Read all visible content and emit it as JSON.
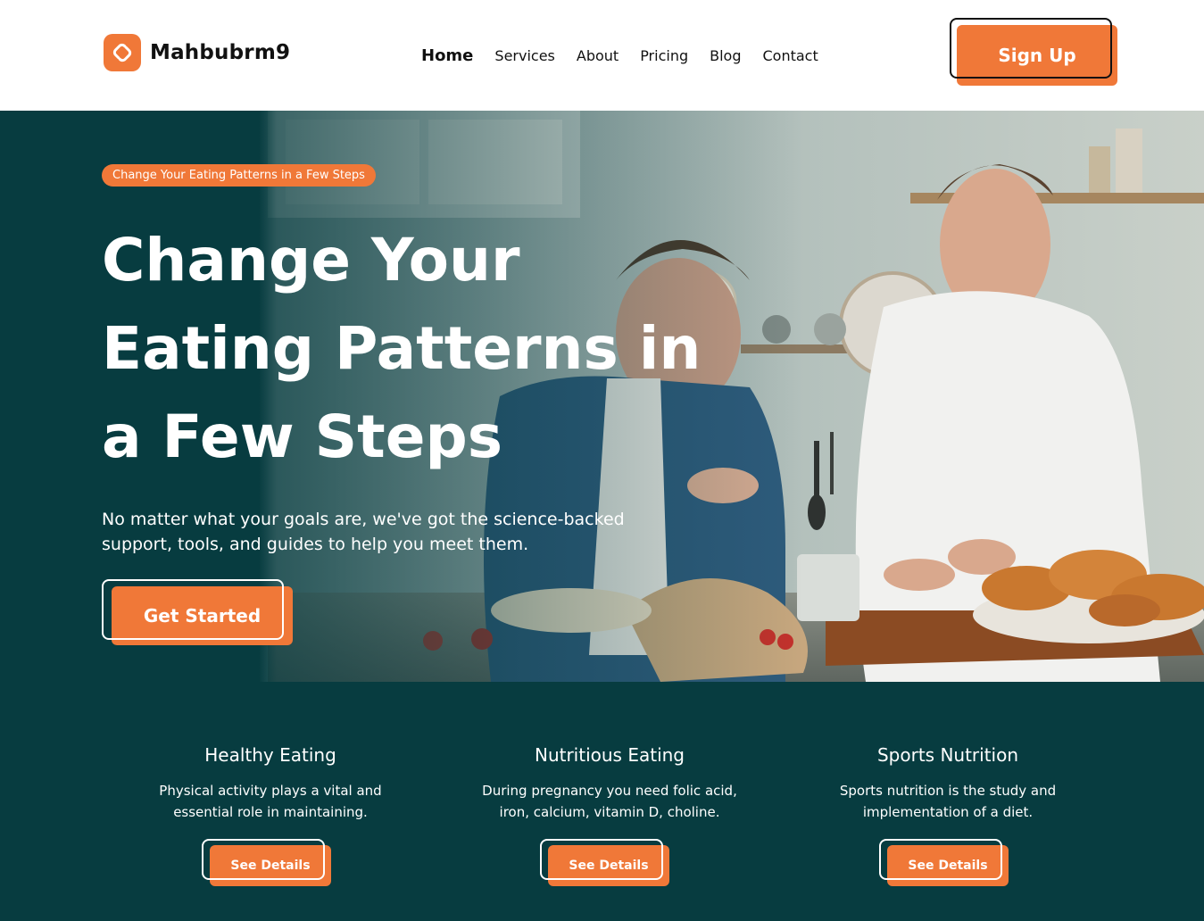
{
  "brand": {
    "name": "Mahbubrm9",
    "logo_icon": "link-icon",
    "accent": "#f07838"
  },
  "nav": {
    "items": [
      {
        "label": "Home",
        "active": true
      },
      {
        "label": "Services",
        "active": false
      },
      {
        "label": "About",
        "active": false
      },
      {
        "label": "Pricing",
        "active": false
      },
      {
        "label": "Blog",
        "active": false
      },
      {
        "label": "Contact",
        "active": false
      }
    ],
    "signup_label": "Sign Up"
  },
  "hero": {
    "badge": "Change Your Eating Patterns in a Few Steps",
    "title_lines": [
      "Change Your",
      "Eating Patterns in",
      "a Few Steps"
    ],
    "subtitle": "No matter what your goals are, we've got the science-backed support, tools, and guides to help you meet them.",
    "cta_label": "Get Started",
    "background_color": "#073c40"
  },
  "features": [
    {
      "title": "Healthy Eating",
      "text": "Physical activity plays a vital and essential role in maintaining.",
      "button": "See Details"
    },
    {
      "title": "Nutritious Eating",
      "text": "During pregnancy you need folic acid, iron, calcium, vitamin D, choline.",
      "button": "See Details"
    },
    {
      "title": "Sports Nutrition",
      "text": "Sports nutrition is the study and implementation of a diet.",
      "button": "See Details"
    }
  ]
}
